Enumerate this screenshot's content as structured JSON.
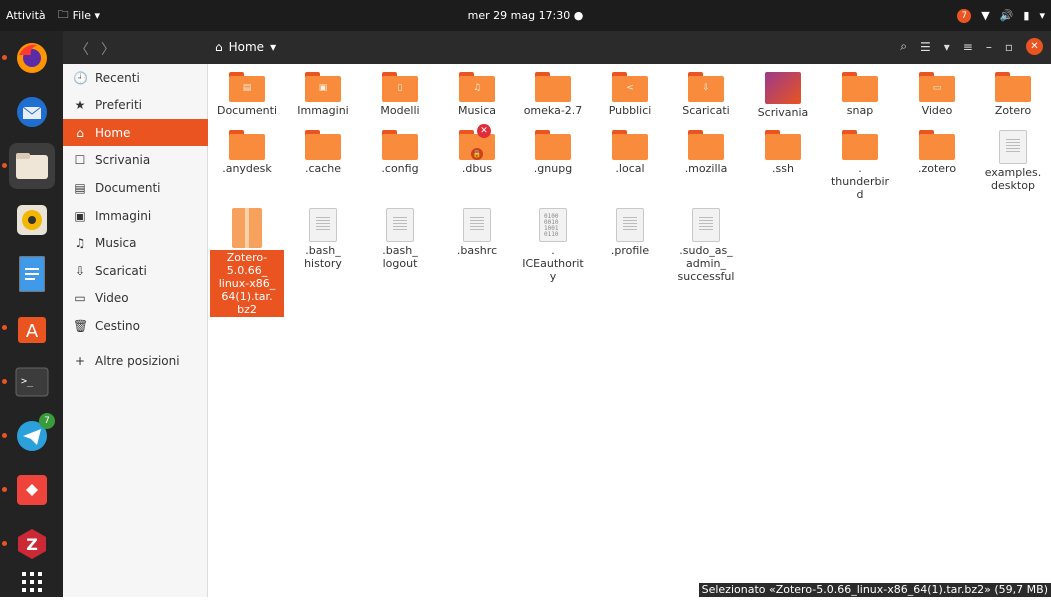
{
  "topbar": {
    "activities": "Attività",
    "app_menu": "File ▾",
    "clock": "mer 29 mag  17:30 ●",
    "notify_count": "7"
  },
  "header": {
    "back": "〈",
    "forward": "〉",
    "path_label": "Home"
  },
  "sidebar": {
    "items": [
      {
        "icon": "🕘",
        "label": "Recenti"
      },
      {
        "icon": "★",
        "label": "Preferiti"
      },
      {
        "icon": "⌂",
        "label": "Home"
      },
      {
        "icon": "☐",
        "label": "Scrivania"
      },
      {
        "icon": "▤",
        "label": "Documenti"
      },
      {
        "icon": "▣",
        "label": "Immagini"
      },
      {
        "icon": "♫",
        "label": "Musica"
      },
      {
        "icon": "⇩",
        "label": "Scaricati"
      },
      {
        "icon": "▭",
        "label": "Video"
      },
      {
        "icon": "🗑",
        "label": "Cestino"
      },
      {
        "icon": "+",
        "label": "Altre posizioni"
      }
    ]
  },
  "files": {
    "row1": [
      "Documenti",
      "Immagini",
      "Modelli",
      "Musica",
      "omeka-2.7",
      "Pubblici",
      "Scaricati",
      "Scrivania",
      "snap",
      "Video",
      "Zotero"
    ],
    "row2": [
      ".anydesk",
      ".cache",
      ".config",
      ".dbus",
      ".gnupg",
      ".local",
      ".mozilla",
      ".ssh",
      ".\nthunderbir\nd",
      ".zotero",
      "examples.\ndesktop"
    ],
    "row3": [
      "Zotero-\n5.0.66_\nlinux-x86_\n64(1).tar.\nbz2",
      ".bash_\nhistory",
      ".bash_\nlogout",
      ".bashrc",
      ".\nICEauthorit\ny",
      ".profile",
      ".sudo_as_\nadmin_\nsuccessful"
    ]
  },
  "dock": {
    "telegram_badge": "7"
  },
  "status": "Selezionato «Zotero-5.0.66_linux-x86_64(1).tar.bz2» (59,7 MB)"
}
